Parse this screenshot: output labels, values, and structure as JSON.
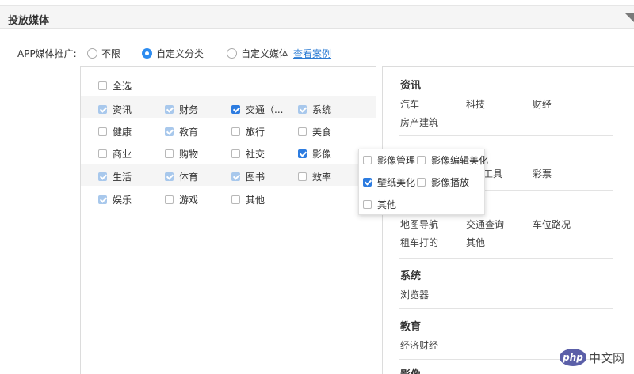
{
  "section": {
    "title": "投放媒体"
  },
  "media": {
    "label": "APP媒体推广:",
    "options": [
      {
        "label": "不限",
        "selected": false
      },
      {
        "label": "自定义分类",
        "selected": true
      },
      {
        "label": "自定义媒体",
        "selected": false
      }
    ],
    "case_link": "查看案例"
  },
  "categories": {
    "select_all": "全选",
    "rows": [
      [
        {
          "label": "资讯",
          "state": "light"
        },
        {
          "label": "财务",
          "state": "light"
        },
        {
          "label": "交通（...",
          "state": "dark"
        },
        {
          "label": "系统",
          "state": "light"
        }
      ],
      [
        {
          "label": "健康",
          "state": "off"
        },
        {
          "label": "教育",
          "state": "light"
        },
        {
          "label": "旅行",
          "state": "off"
        },
        {
          "label": "美食",
          "state": "off"
        }
      ],
      [
        {
          "label": "商业",
          "state": "off"
        },
        {
          "label": "购物",
          "state": "off"
        },
        {
          "label": "社交",
          "state": "off"
        },
        {
          "label": "影像",
          "state": "dark"
        }
      ],
      [
        {
          "label": "生活",
          "state": "light"
        },
        {
          "label": "体育",
          "state": "light"
        },
        {
          "label": "图书",
          "state": "light"
        },
        {
          "label": "效率",
          "state": "off"
        }
      ],
      [
        {
          "label": "娱乐",
          "state": "light"
        },
        {
          "label": "游戏",
          "state": "off"
        },
        {
          "label": "其他",
          "state": "off"
        }
      ]
    ]
  },
  "popup": {
    "items": [
      {
        "label": "影像管理",
        "state": "off"
      },
      {
        "label": "影像编辑美化",
        "state": "off"
      },
      {
        "label": "壁纸美化",
        "state": "dark"
      },
      {
        "label": "影像播放",
        "state": "off"
      },
      {
        "label": "其他",
        "state": "off"
      }
    ]
  },
  "selected": {
    "groups": [
      {
        "title": "资讯",
        "items": [
          "汽车",
          "科技",
          "财经",
          "房产建筑"
        ]
      },
      {
        "title": "",
        "items": [
          "工具",
          "彩票"
        ]
      },
      {
        "title": "",
        "items": [
          "地图导航",
          "交通查询",
          "车位路况",
          "租车打的",
          "其他"
        ]
      },
      {
        "title": "系统",
        "items": [
          "浏览器"
        ]
      },
      {
        "title": "教育",
        "items": [
          "经济财经"
        ]
      },
      {
        "title": "影像",
        "items": []
      }
    ]
  },
  "watermark": {
    "logo": "php",
    "text": "中文网"
  }
}
